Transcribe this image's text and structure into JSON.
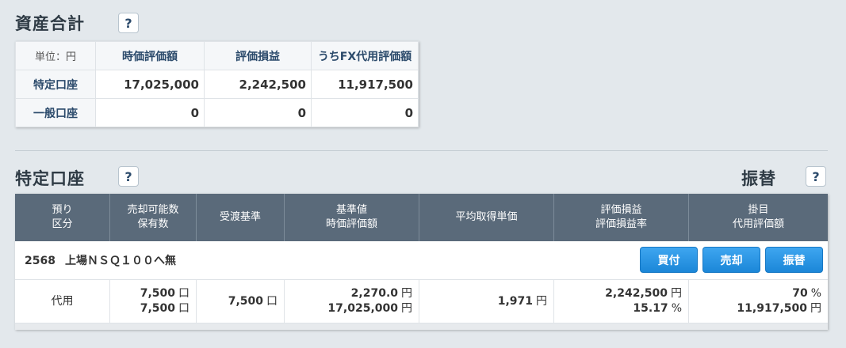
{
  "asset_total": {
    "title": "資産合計",
    "help": "?",
    "unit_label": "単位：円",
    "headers": [
      "時価評価額",
      "評価損益",
      "うちFX代用評価額"
    ],
    "rows": [
      {
        "label": "特定口座",
        "values": [
          "17,025,000",
          "2,242,500",
          "11,917,500"
        ]
      },
      {
        "label": "一般口座",
        "values": [
          "0",
          "0",
          "0"
        ]
      }
    ]
  },
  "tokutei": {
    "title": "特定口座",
    "help": "?",
    "transfer_title": "振替",
    "transfer_help": "?",
    "headers": [
      [
        "預り",
        "区分"
      ],
      [
        "売却可能数",
        "保有数"
      ],
      [
        "受渡基準",
        ""
      ],
      [
        "基準値",
        "時価評価額"
      ],
      [
        "平均取得単価",
        ""
      ],
      [
        "評価損益",
        "評価損益率"
      ],
      [
        "掛目",
        "代用評価額"
      ]
    ],
    "product": {
      "code": "2568",
      "name": "上場ＮＳＱ１００へ無",
      "buttons": {
        "buy": "買付",
        "sell": "売却",
        "transfer": "振替"
      }
    },
    "row": {
      "category": "代用",
      "sellable": "7,500",
      "sellable_unit": "口",
      "held": "7,500",
      "held_unit": "口",
      "delivery": "7,500",
      "delivery_unit": "口",
      "base_price": "2,270.0",
      "base_price_unit": "円",
      "market_value": "17,025,000",
      "market_value_unit": "円",
      "avg_cost": "1,971",
      "avg_cost_unit": "円",
      "pnl": "2,242,500",
      "pnl_unit": "円",
      "pnl_rate": "15.17",
      "pnl_rate_unit": "%",
      "haircut": "70",
      "haircut_unit": "%",
      "collateral_value": "11,917,500",
      "collateral_value_unit": "円"
    }
  },
  "colors": {
    "header_bg": "#5a6a7a",
    "button": "#2a93e2",
    "label_text": "#2b4a6b"
  }
}
